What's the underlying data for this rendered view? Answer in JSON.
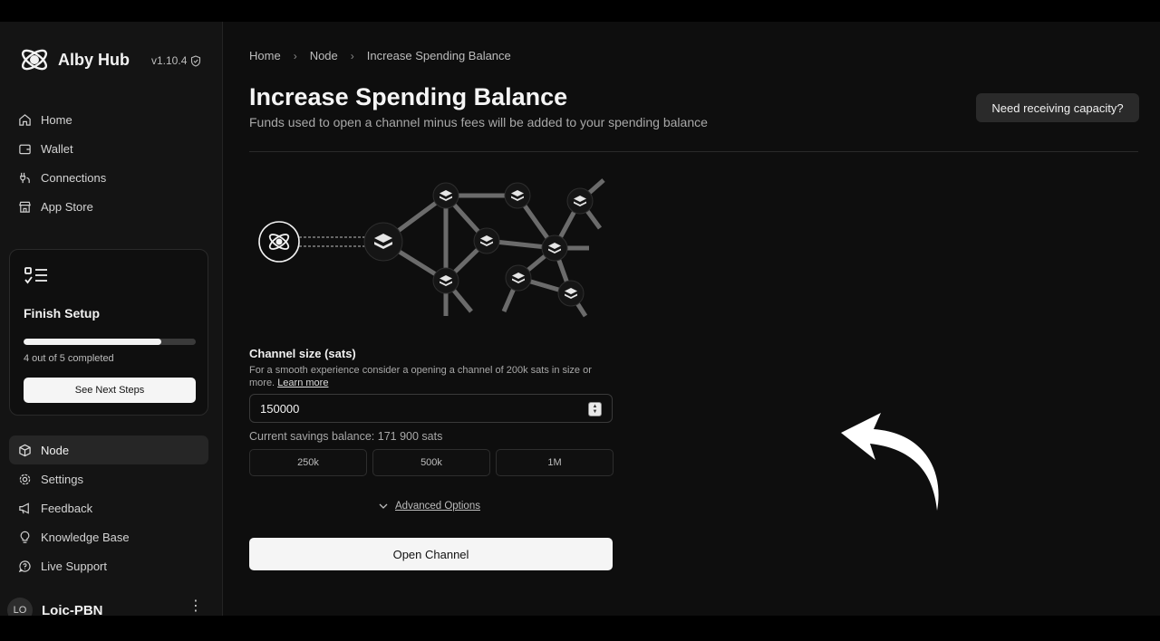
{
  "app": {
    "name": "Alby Hub",
    "version": "v1.10.4"
  },
  "sidebar": {
    "nav_top": [
      {
        "label": "Home",
        "icon": "home-icon"
      },
      {
        "label": "Wallet",
        "icon": "wallet-icon"
      },
      {
        "label": "Connections",
        "icon": "connections-icon"
      },
      {
        "label": "App Store",
        "icon": "store-icon"
      }
    ],
    "setup": {
      "title": "Finish Setup",
      "progress": 0.8,
      "count_text": "4 out of 5 completed",
      "button": "See Next Steps"
    },
    "nav_bottom": [
      {
        "label": "Node",
        "icon": "node-icon",
        "active": true
      },
      {
        "label": "Settings",
        "icon": "settings-icon"
      },
      {
        "label": "Feedback",
        "icon": "feedback-icon"
      },
      {
        "label": "Knowledge Base",
        "icon": "lightbulb-icon"
      },
      {
        "label": "Live Support",
        "icon": "support-icon"
      }
    ],
    "user": {
      "initials": "LO",
      "name": "Loic-PBN"
    }
  },
  "breadcrumb": [
    "Home",
    "Node",
    "Increase Spending Balance"
  ],
  "page": {
    "title": "Increase Spending Balance",
    "subtitle": "Funds used to open a channel minus fees will be added to your spending balance",
    "capacity_button": "Need receiving capacity?"
  },
  "form": {
    "label": "Channel size (sats)",
    "help": "For a smooth experience consider a opening a channel of 200k sats in size or more.",
    "learn_more": "Learn more",
    "value": "150000",
    "savings_text": "Current savings balance: 171 900 sats",
    "presets": [
      "250k",
      "500k",
      "1M"
    ],
    "advanced": "Advanced Options",
    "submit": "Open Channel"
  },
  "colors": {
    "background": "#0e0e0e",
    "sidebar": "#141414",
    "primary_button": "#f5f5f5",
    "accent_text": "#f2f2f2"
  }
}
